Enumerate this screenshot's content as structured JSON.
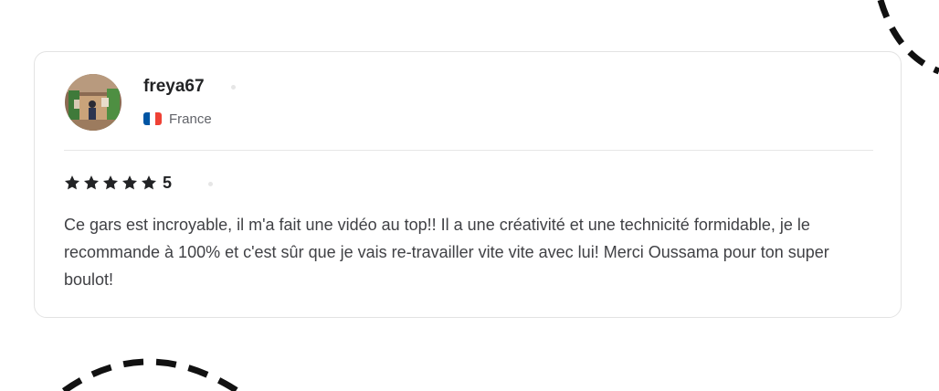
{
  "review": {
    "username": "freya67",
    "country": "France",
    "flag_colors": [
      "#0055a4",
      "#ffffff",
      "#ef4135"
    ],
    "rating": {
      "stars": 5,
      "value_label": "5",
      "star_color": "#222325"
    },
    "text": "Ce gars est incroyable, il m'a fait une vidéo au top!! Il a une créativité et une technicité formidable, je le recommande à 100% et c'est sûr que je vais re-travailler vite vite avec lui! Merci Oussama pour ton super boulot!"
  },
  "icons": {
    "avatar": "user-avatar-photo",
    "flag": "france-flag-icon",
    "star": "star-icon"
  },
  "colors": {
    "card_border": "#e3e3e3",
    "text_primary": "#222325",
    "text_secondary": "#62646a",
    "text_body": "#404145",
    "decoration": "#111111"
  }
}
